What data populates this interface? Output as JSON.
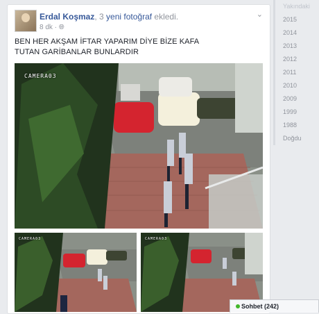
{
  "post": {
    "author": "Erdal Koşmaz",
    "action_prefix": ", 3",
    "action_link": " yeni fotoğraf",
    "action_suffix": " ekledi.",
    "timestamp": "8 dk · ",
    "privacy_icon": "globe-icon",
    "text": "BEN HER AKŞAM İFTAR YAPARIM DİYE BİZE KAFA TUTAN GARİBANLAR BUNLARDIR",
    "photos": [
      {
        "camera_label": "CAMERA03"
      },
      {
        "camera_label": "CAMERA03"
      },
      {
        "camera_label": "CAMERA03"
      }
    ]
  },
  "timeline": {
    "years": [
      "Yakındaki",
      "2015",
      "2014",
      "2013",
      "2012",
      "2011",
      "2010",
      "2009",
      "1999",
      "1988",
      "Doğdu"
    ]
  },
  "chat": {
    "label": "Sohbet (242)"
  },
  "colors": {
    "link": "#365899",
    "muted": "#90949c",
    "online": "#42b72a"
  }
}
